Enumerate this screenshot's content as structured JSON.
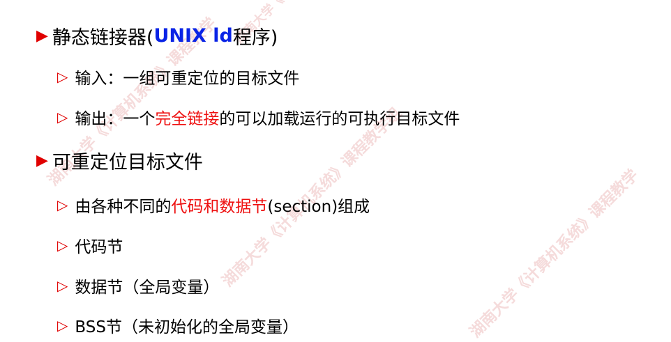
{
  "watermark": {
    "text": "湖南大学《计算机系统》课程教学组",
    "text_short": "湖南大学《计算机系统》课程教学"
  },
  "bullets": {
    "level1_icon": "filled-triangle-bullet",
    "level2_icon": "outline-triangle-bullet",
    "level1_glyph": "▶",
    "level2_glyph": "▷",
    "color": "#e00000"
  },
  "items": [
    {
      "pre": "静态链接器(",
      "highlight": "UNIX ld",
      "post": "程序)"
    },
    {
      "text": "输入：一组可重定位的目标文件"
    },
    {
      "pre": "输出：一个",
      "highlight": "完全链接",
      "post": "的可以加载运行的可执行目标文件"
    },
    {
      "text": "可重定位目标文件"
    },
    {
      "pre": "由各种不同的",
      "highlight": "代码和数据节",
      "post": "(section)组成"
    },
    {
      "text": "代码节"
    },
    {
      "text": "数据节（全局变量）"
    },
    {
      "text": "BSS节（未初始化的全局变量）"
    }
  ]
}
